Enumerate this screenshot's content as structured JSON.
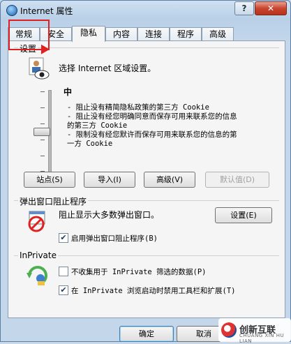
{
  "window": {
    "title": "Internet 属性",
    "help_label": "?",
    "close_label": "✕"
  },
  "tabs": [
    {
      "label": "常规"
    },
    {
      "label": "安全"
    },
    {
      "label": "隐私"
    },
    {
      "label": "内容"
    },
    {
      "label": "连接"
    },
    {
      "label": "程序"
    },
    {
      "label": "高级"
    }
  ],
  "active_tab": "隐私",
  "settings": {
    "group_label": "设置",
    "description": "选择 Internet 区域设置。",
    "level": "中",
    "lines": [
      "- 阻止没有精简隐私政策的第三方 Cookie",
      "- 阻止没有经您明确同意而保存可用来联系您的信息",
      "的第三方 Cookie",
      "- 限制没有经您默许而保存可用来联系您的信息的第",
      "一方 Cookie"
    ],
    "buttons": {
      "sites": "站点(S)",
      "import": "导入(I)",
      "advanced": "高级(V)",
      "default": "默认值(D)"
    }
  },
  "popup": {
    "group_label": "弹出窗口阻止程序",
    "description": "阻止显示大多数弹出窗口。",
    "settings_button": "设置(E)",
    "enable_label": "启用弹出窗口阻止程序(B)",
    "enable_checked": true
  },
  "inprivate": {
    "group_label": "InPrivate",
    "option1_label": "不收集用于 InPrivate 筛选的数据(P)",
    "option1_checked": false,
    "option2_label": "在 InPrivate 浏览启动时禁用工具栏和扩展(T)",
    "option2_checked": true
  },
  "footer": {
    "ok": "确定",
    "cancel": "取消"
  },
  "watermark": {
    "text": "创新互联",
    "sub": "CHUANG XIN HU LIAN"
  },
  "colors": {
    "highlight": "#e02020",
    "close": "#c9452e",
    "accent": "#3c7fb1"
  }
}
